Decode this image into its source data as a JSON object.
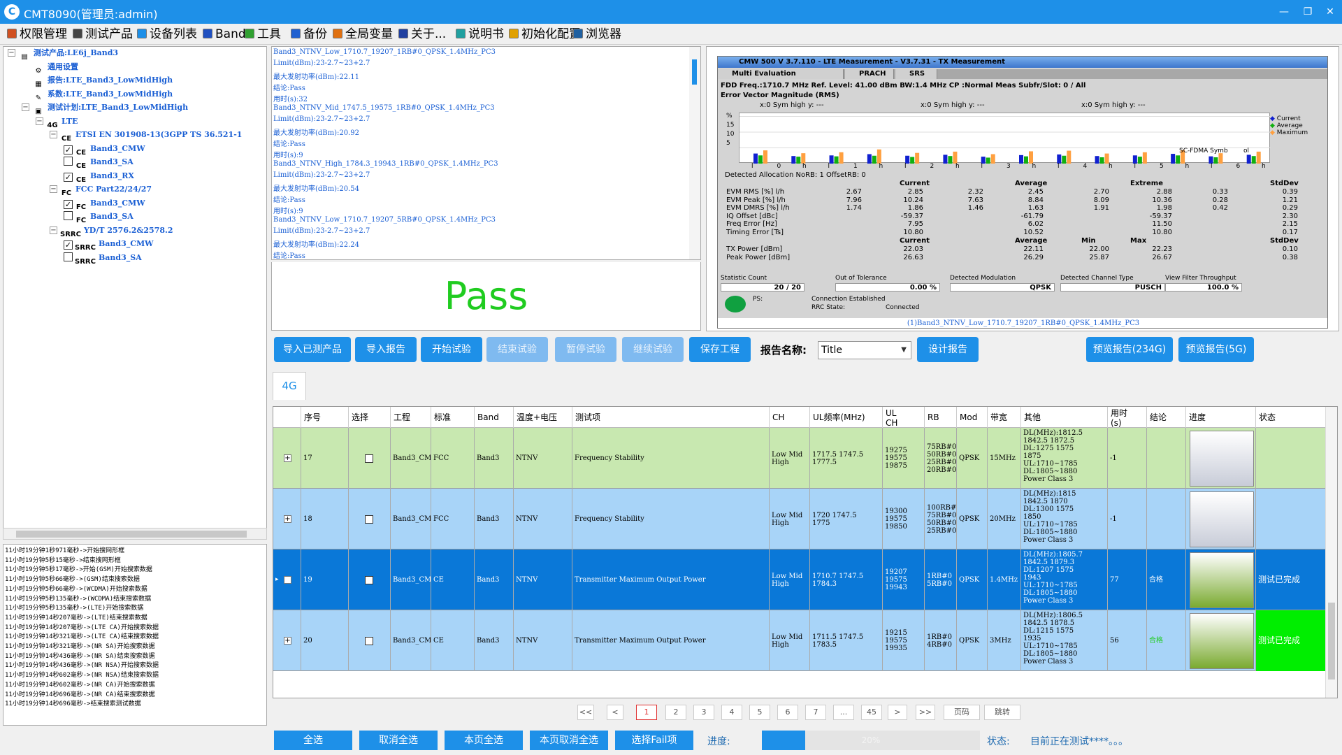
{
  "window": {
    "title": "CMT8090(管理员:admin)",
    "min": "—",
    "restore": "❐",
    "close": "✕"
  },
  "menu": [
    {
      "label": "权限管理",
      "icon": "permission-icon",
      "color": "#d05020"
    },
    {
      "label": "测试产品",
      "icon": "product-icon",
      "color": "#444444"
    },
    {
      "label": "设备列表",
      "icon": "device-icon",
      "color": "#1e90e8"
    },
    {
      "label": "Band",
      "icon": "band-icon",
      "color": "#2050c0"
    },
    {
      "label": "工具",
      "icon": "tool-icon",
      "color": "#30a030"
    },
    {
      "label": "备份",
      "icon": "backup-icon",
      "color": "#2060d0"
    },
    {
      "label": "全局变量",
      "icon": "global-variable-icon",
      "color": "#e07010"
    },
    {
      "label": "关于...",
      "icon": "about-icon",
      "color": "#2040a0"
    },
    {
      "label": "说明书",
      "icon": "manual-icon",
      "color": "#20a0a0"
    },
    {
      "label": "初始化配置",
      "icon": "init-config-icon",
      "color": "#e0a000"
    },
    {
      "label": "浏览器",
      "icon": "browser-icon",
      "color": "#2060a0"
    }
  ],
  "tree": [
    {
      "label": "测试产品:LE6j_Band3",
      "toggle": "−",
      "icon": "▤",
      "checkbox": ""
    },
    {
      "label": "通用设置",
      "toggle": "",
      "icon": "⚙",
      "checkbox": ""
    },
    {
      "label": "报告:LTE_Band3_LowMidHigh",
      "toggle": "",
      "icon": "▦",
      "checkbox": ""
    },
    {
      "label": "系数:LTE_Band3_LowMidHigh",
      "toggle": "",
      "icon": "✎",
      "checkbox": ""
    },
    {
      "label": "测试计划:LTE_Band3_LowMidHigh",
      "toggle": "−",
      "icon": "▣",
      "checkbox": ""
    },
    {
      "label": "LTE",
      "toggle": "−",
      "icon": "4G",
      "checkbox": ""
    },
    {
      "label": "ETSI EN 301908-13(3GPP TS 36.521-1",
      "toggle": "−",
      "icon": "CE",
      "checkbox": ""
    },
    {
      "label": "Band3_CMW",
      "toggle": "",
      "icon": "CE",
      "checkbox": "✓"
    },
    {
      "label": "Band3_SA",
      "toggle": "",
      "icon": "CE",
      "checkbox": ""
    },
    {
      "label": "Band3_RX",
      "toggle": "",
      "icon": "CE",
      "checkbox": "✓"
    },
    {
      "label": "FCC Part22/24/27",
      "toggle": "−",
      "icon": "FC",
      "checkbox": ""
    },
    {
      "label": "Band3_CMW",
      "toggle": "",
      "icon": "FC",
      "checkbox": "✓"
    },
    {
      "label": "Band3_SA",
      "toggle": "",
      "icon": "FC",
      "checkbox": ""
    },
    {
      "label": "YD/T 2576.2&2578.2",
      "toggle": "−",
      "icon": "SRRC",
      "checkbox": ""
    },
    {
      "label": "Band3_CMW",
      "toggle": "",
      "icon": "SRRC",
      "checkbox": "✓"
    },
    {
      "label": "Band3_SA",
      "toggle": "",
      "icon": "SRRC",
      "checkbox": ""
    }
  ],
  "log": [
    "11小时19分钟1秒971毫秒->开始搜网形框",
    "11小时19分钟5秒15毫秒->结束搜网形框",
    "11小时19分钟5秒17毫秒->开始(GSM)开始搜索数据",
    "11小时19分钟5秒66毫秒->(GSM)结束搜索数据",
    "11小时19分钟5秒66毫秒->(WCDMA)开始搜索数据",
    "11小时19分钟5秒135毫秒->(WCDMA)结束搜索数据",
    "11小时19分钟5秒135毫秒->(LTE)开始搜索数据",
    "11小时19分钟14秒207毫秒->(LTE)结束搜索数据",
    "11小时19分钟14秒207毫秒->(LTE CA)开始搜索数据",
    "11小时19分钟14秒321毫秒->(LTE CA)结束搜索数据",
    "11小时19分钟14秒321毫秒->(NR SA)开始搜索数据",
    "11小时19分钟14秒436毫秒->(NR SA)结束搜索数据",
    "11小时19分钟14秒436毫秒->(NR NSA)开始搜索数据",
    "11小时19分钟14秒602毫秒->(NR NSA)结束搜索数据",
    "11小时19分钟14秒602毫秒->(NR CA)开始搜索数据",
    "11小时19分钟14秒696毫秒->(NR CA)结束搜索数据",
    "11小时19分钟14秒696毫秒->结束搜索测试数据"
  ],
  "results": [
    "Band3_NTNV_Low_1710.7_19207_1RB#0_QPSK_1.4MHz_PC3",
    "      Limit(dBm):23-2.7~23+2.7",
    "最大发射功率(dBm):22.11",
    "               结论:Pass",
    "            用时(s):32",
    "Band3_NTNV_Mid_1747.5_19575_1RB#0_QPSK_1.4MHz_PC3",
    "      Limit(dBm):23-2.7~23+2.7",
    "最大发射功率(dBm):20.92",
    "               结论:Pass",
    "            用时(s):9",
    "Band3_NTNV_High_1784.3_19943_1RB#0_QPSK_1.4MHz_PC3",
    "      Limit(dBm):23-2.7~23+2.7",
    "最大发射功率(dBm):20.54",
    "               结论:Pass",
    "            用时(s):9",
    "Band3_NTNV_Low_1710.7_19207_5RB#0_QPSK_1.4MHz_PC3",
    "      Limit(dBm):23-2.7~23+2.7",
    "最大发射功率(dBm):22.24",
    "               结论:Pass"
  ],
  "pass_text": "Pass",
  "cmw": {
    "title": "CMW 500 V 3.7.110 - LTE Measurement  - V3.7.31 - TX Measurement",
    "tabs": [
      "Multi Evaluation",
      "PRACH",
      "SRS"
    ],
    "info": "FDD        Freq.:1710.7 MHz  Ref. Level:    41.00 dBm  BW:1.4 MHz      CP :Normal       Meas Subfr/Slot:     0   / All",
    "subtitle": "Error Vector Magnitude (RMS)",
    "markers": [
      "x:0 Sym high y:      ---",
      "x:0 Sym high y:      ---",
      "x:0 Sym high y:      ---"
    ],
    "chart_y_ticks": [
      "%",
      "15",
      "10",
      "5"
    ],
    "chart_x_ticks": [
      "l",
      "0",
      "h",
      "l",
      "1",
      "h",
      "l",
      "2",
      "h",
      "l",
      "3",
      "h",
      "l",
      "4",
      "h",
      "l",
      "5",
      "h",
      "l",
      "6",
      "h"
    ],
    "sc_label": "SC-FDMA Symb",
    "sc_suffix": "ol",
    "legend": [
      "Current",
      "Average",
      "Maximum"
    ],
    "alloc": "Detected Allocation     NoRB:                       1 OffsetRB:                    0",
    "col_heads": [
      "Current",
      "Average",
      "Extreme",
      "StdDev"
    ],
    "rows": [
      {
        "label": "EVM RMS [%]  l/h",
        "vals": [
          "2.67",
          "2.85",
          "2.32",
          "2.45",
          "2.70",
          "2.88",
          "0.33",
          "0.39"
        ]
      },
      {
        "label": "EVM Peak [%]  l/h",
        "vals": [
          "7.96",
          "10.24",
          "7.63",
          "8.84",
          "8.09",
          "10.36",
          "0.28",
          "1.21"
        ]
      },
      {
        "label": "EVM DMRS [%]  l/h",
        "vals": [
          "1.74",
          "1.86",
          "1.46",
          "1.63",
          "1.91",
          "1.98",
          "0.42",
          "0.29"
        ]
      },
      {
        "label": "IQ Offset [dBc]",
        "vals": [
          "",
          "-59.37",
          "",
          "-61.79",
          "",
          "-59.37",
          "",
          "2.30"
        ]
      },
      {
        "label": "Freq Error [Hz]",
        "vals": [
          "",
          "7.95",
          "",
          "6.02",
          "",
          "11.50",
          "",
          "2.15"
        ]
      },
      {
        "label": "Timing Error [Ts]",
        "vals": [
          "",
          "10.80",
          "",
          "10.52",
          "",
          "10.80",
          "",
          "0.17"
        ]
      }
    ],
    "col_heads2": [
      "Current",
      "Average",
      "Min",
      "Max",
      "StdDev"
    ],
    "rows2": [
      {
        "label": "TX Power [dBm]",
        "vals": [
          "22.03",
          "22.11",
          "22.00",
          "22.23",
          "0.10"
        ]
      },
      {
        "label": "Peak Power [dBm]",
        "vals": [
          "26.63",
          "26.29",
          "25.87",
          "26.67",
          "0.38"
        ]
      }
    ],
    "footer_labels": [
      "Statistic Count",
      "Out of Tolerance",
      "Detected Modulation",
      "Detected Channel Type",
      "View Filter Throughput"
    ],
    "footer_vals": [
      "20 / 20",
      "0.00  %",
      "QPSK",
      "PUSCH",
      "100.0  %"
    ],
    "ps": "PS:",
    "conn1": "Connection Established",
    "rrc": "RRC State:",
    "conn2": "Connected",
    "caption": "(1)Band3_NTNV_Low_1710.7_19207_1RB#0_QPSK_1.4MHz_PC3",
    "bar_values_cur": [
      3.2,
      2.4,
      2.6,
      3.0,
      2.5,
      2.8,
      2.2,
      2.7,
      2.9,
      2.4,
      2.6,
      3.1,
      2.3,
      2.8
    ],
    "bar_values_avg": [
      2.6,
      2.2,
      2.3,
      2.5,
      2.1,
      2.4,
      1.9,
      2.3,
      2.5,
      2.0,
      2.2,
      2.6,
      2.0,
      2.4
    ],
    "bar_values_max": [
      4.2,
      3.3,
      3.6,
      4.5,
      3.4,
      3.8,
      3.0,
      3.9,
      4.1,
      3.2,
      3.6,
      4.3,
      3.3,
      3.8
    ],
    "bar_color_cur": "#1020d0",
    "bar_color_avg": "#10b010",
    "bar_color_max": "#ffa040"
  },
  "toolbar": {
    "import_product": "导入已测产品",
    "import_report": "导入报告",
    "start": "开始试验",
    "stop": "结束试验",
    "pause": "暂停试验",
    "resume": "继续试验",
    "save": "保存工程",
    "report_label": "报告名称:",
    "report_name": "Title",
    "design_report": "设计报告",
    "preview_234g": "预览报告(234G)",
    "preview_5g": "预览报告(5G)"
  },
  "tab_label": "4G",
  "grid": {
    "headers": [
      "",
      "序号",
      "选择",
      "工程",
      "标准",
      "Band",
      "温度+电压",
      "测试项",
      "CH",
      "UL频率(MHz)",
      "UL\nCH",
      "RB",
      "Mod",
      "带宽",
      "其他",
      "用时\n(s)",
      "结论",
      "进度",
      "状态"
    ],
    "rows": [
      {
        "no": "17",
        "project": "Band3_CMW",
        "std": "FCC",
        "band": "Band3",
        "cond": "NTNV",
        "item": "Frequency Stability",
        "ch": "Low Mid\nHigh",
        "ulf": "1717.5 1747.5\n1777.5",
        "ulch": "19275\n19575\n19875",
        "rb": "75RB#0\n50RB#0\n25RB#0\n20RB#0",
        "mod": "QPSK",
        "bw": "15MHz",
        "other": "DL(MHz):1812.5\n1842.5 1872.5\nDL:1275 1575\n1875\nUL:1710~1785\nDL:1805~1880\nPower Class 3",
        "time": "-1",
        "verdict": "",
        "status": "",
        "bg": "#c8e8b0",
        "progress": "0",
        "pcolor": "#c8ccd8",
        "marker": ""
      },
      {
        "no": "18",
        "project": "Band3_CMW",
        "std": "FCC",
        "band": "Band3",
        "cond": "NTNV",
        "item": "Frequency Stability",
        "ch": "Low Mid\nHigh",
        "ulf": "1720 1747.5\n1775",
        "ulch": "19300\n19575\n19850",
        "rb": "100RB#0\n75RB#0\n50RB#0\n25RB#0",
        "mod": "QPSK",
        "bw": "20MHz",
        "other": "DL(MHz):1815\n1842.5 1870\nDL:1300 1575\n1850\nUL:1710~1785\nDL:1805~1880\nPower Class 3",
        "time": "-1",
        "verdict": "",
        "status": "",
        "bg": "#a8d4f8",
        "progress": "0",
        "pcolor": "#c8ccd8",
        "marker": ""
      },
      {
        "no": "19",
        "project": "Band3_CMW",
        "std": "CE",
        "band": "Band3",
        "cond": "NTNV",
        "item": "Transmitter Maximum Output Power",
        "ch": "Low Mid\nHigh",
        "ulf": "1710.7 1747.5\n1784.3",
        "ulch": "19207\n19575\n19943",
        "rb": "1RB#0\n5RB#0",
        "mod": "QPSK",
        "bw": "1.4MHz",
        "other": "DL(MHz):1805.7\n1842.5 1879.3\nDL:1207 1575\n1943\nUL:1710~1785\nDL:1805~1880\nPower Class 3",
        "time": "77",
        "verdict": "合格",
        "status": "测试已完成",
        "bg": "#0a78d8",
        "progress": "1",
        "pcolor": "#7aaa30",
        "marker": "▸"
      },
      {
        "no": "20",
        "project": "Band3_CMW",
        "std": "CE",
        "band": "Band3",
        "cond": "NTNV",
        "item": "Transmitter Maximum Output Power",
        "ch": "Low Mid\nHigh",
        "ulf": "1711.5 1747.5\n1783.5",
        "ulch": "19215\n19575\n19935",
        "rb": "1RB#0\n4RB#0",
        "mod": "QPSK",
        "bw": "3MHz",
        "other": "DL(MHz):1806.5\n1842.5 1878.5\nDL:1215 1575\n1935\nUL:1710~1785\nDL:1805~1880\nPower Class 3",
        "time": "56",
        "verdict": "合格",
        "status": "测试已完成",
        "bg": "#a8d4f8",
        "progress": "1",
        "pcolor": "#7aaa30",
        "marker": ""
      }
    ]
  },
  "pager": [
    "<<",
    "<",
    "1",
    "2",
    "3",
    "4",
    "5",
    "6",
    "7",
    "...",
    "45",
    ">",
    ">>",
    "页码",
    "跳转"
  ],
  "bottom": {
    "select_all": "全选",
    "unselect_all": "取消全选",
    "page_select": "本页全选",
    "page_unselect": "本页取消全选",
    "select_fail": "选择Fail项",
    "progress_label": "进度:",
    "progress_text": "20%",
    "progress_value": 0.2,
    "status_label": "状态:",
    "status_text": "目前正在测试****。。。"
  }
}
